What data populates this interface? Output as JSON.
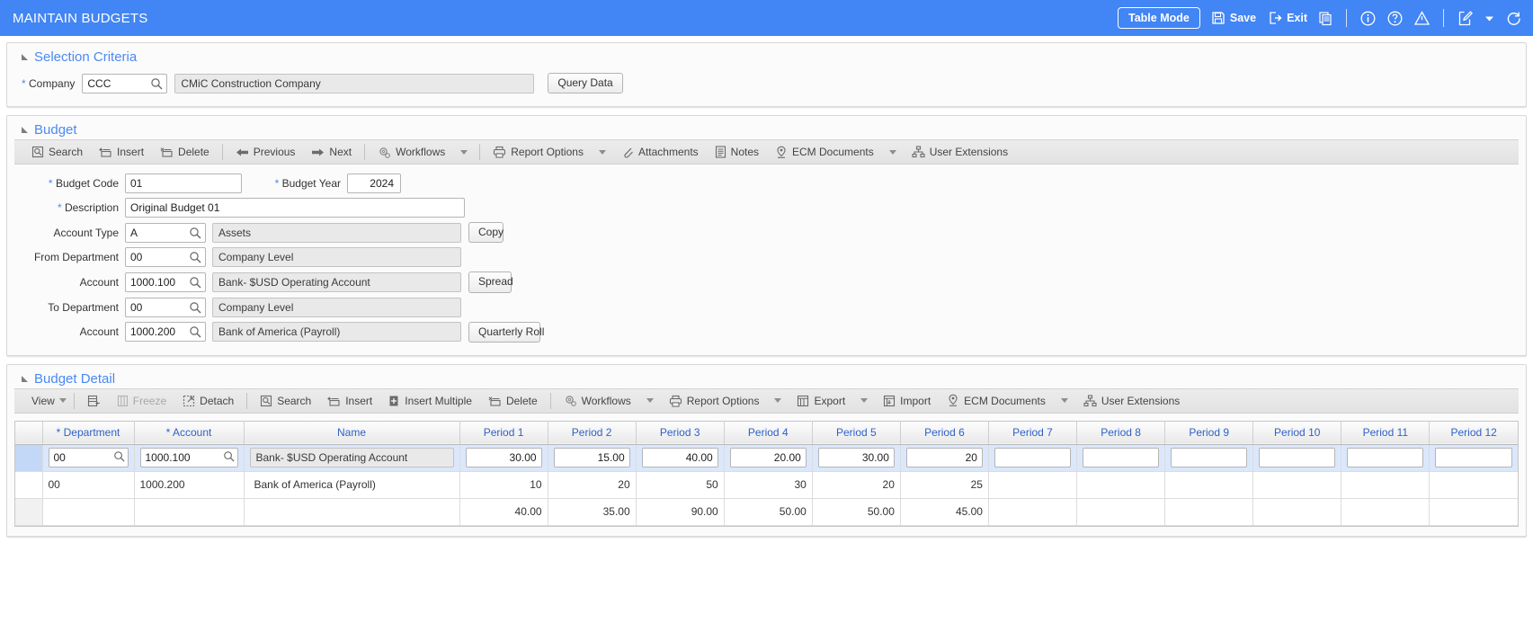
{
  "appbar": {
    "title": "MAINTAIN BUDGETS",
    "table_mode": "Table Mode",
    "save": "Save",
    "exit": "Exit",
    "accent": "#4285f4",
    "icons": [
      "copy-icon",
      "info-icon",
      "help-icon",
      "warning-icon",
      "edit-icon",
      "chevron-down-icon",
      "refresh-icon"
    ]
  },
  "selection_criteria": {
    "title": "Selection Criteria",
    "company_label": "Company",
    "company_code": "CCC",
    "company_name": "CMiC Construction Company",
    "query_data": "Query Data"
  },
  "budget": {
    "title": "Budget",
    "toolbar": [
      {
        "label": "Search",
        "icon": "search-icon",
        "caret": false
      },
      {
        "label": "Insert",
        "icon": "insert-icon",
        "caret": false
      },
      {
        "label": "Delete",
        "icon": "delete-icon",
        "caret": false
      },
      {
        "label": "Previous",
        "icon": "arrow-left-icon",
        "caret": false
      },
      {
        "label": "Next",
        "icon": "arrow-right-icon",
        "caret": false
      },
      {
        "label": "Workflows",
        "icon": "workflows-icon",
        "caret": true
      },
      {
        "label": "Report Options",
        "icon": "printer-icon",
        "caret": true
      },
      {
        "label": "Attachments",
        "icon": "paperclip-icon",
        "caret": false
      },
      {
        "label": "Notes",
        "icon": "notes-icon",
        "caret": false
      },
      {
        "label": "ECM Documents",
        "icon": "ecm-icon",
        "caret": true
      },
      {
        "label": "User Extensions",
        "icon": "user-extensions-icon",
        "caret": false
      }
    ],
    "fields": {
      "budget_code_label": "Budget Code",
      "budget_code": "01",
      "budget_year_label": "Budget Year",
      "budget_year": "2024",
      "description_label": "Description",
      "description": "Original Budget 01",
      "account_type_label": "Account Type",
      "account_type_code": "A",
      "account_type_name": "Assets",
      "from_department_label": "From Department",
      "from_department_code": "00",
      "from_department_name": "Company Level",
      "from_account_label": "Account",
      "from_account_code": "1000.100",
      "from_account_name": "Bank- $USD Operating Account",
      "to_department_label": "To Department",
      "to_department_code": "00",
      "to_department_name": "Company Level",
      "to_account_label": "Account",
      "to_account_code": "1000.200",
      "to_account_name": "Bank of America (Payroll)"
    },
    "buttons": {
      "copy": "Copy",
      "spread": "Spread",
      "quarterly_roll": "Quarterly Roll"
    }
  },
  "budget_detail": {
    "title": "Budget Detail",
    "toolbar": [
      {
        "label": "View",
        "icon": "view-icon",
        "caret": true,
        "disabled": false
      },
      {
        "label": "",
        "icon": "detach-columns-icon",
        "caret": false,
        "disabled": false
      },
      {
        "label": "Freeze",
        "icon": "freeze-icon",
        "caret": false,
        "disabled": true
      },
      {
        "label": "Detach",
        "icon": "detach-icon",
        "caret": false,
        "disabled": false
      },
      {
        "label": "Search",
        "icon": "search-icon",
        "caret": false,
        "disabled": false
      },
      {
        "label": "Insert",
        "icon": "insert-icon",
        "caret": false,
        "disabled": false
      },
      {
        "label": "Insert Multiple",
        "icon": "insert-multiple-icon",
        "caret": false,
        "disabled": false
      },
      {
        "label": "Delete",
        "icon": "delete-icon",
        "caret": false,
        "disabled": false
      },
      {
        "label": "Workflows",
        "icon": "workflows-icon",
        "caret": true,
        "disabled": false
      },
      {
        "label": "Report Options",
        "icon": "printer-icon",
        "caret": true,
        "disabled": false
      },
      {
        "label": "Export",
        "icon": "export-icon",
        "caret": true,
        "disabled": false
      },
      {
        "label": "Import",
        "icon": "import-icon",
        "caret": false,
        "disabled": false
      },
      {
        "label": "ECM Documents",
        "icon": "ecm-icon",
        "caret": true,
        "disabled": false
      },
      {
        "label": "User Extensions",
        "icon": "user-extensions-icon",
        "caret": false,
        "disabled": false
      }
    ],
    "columns": [
      "* Department",
      "* Account",
      "Name",
      "Period 1",
      "Period 2",
      "Period 3",
      "Period 4",
      "Period 5",
      "Period 6",
      "Period 7",
      "Period 8",
      "Period 9",
      "Period 10",
      "Period 11",
      "Period 12"
    ],
    "rows": [
      {
        "selected": true,
        "department": "00",
        "account": "1000.100",
        "name": "Bank- $USD Operating Account",
        "periods": [
          "30.00",
          "15.00",
          "40.00",
          "20.00",
          "30.00",
          "20",
          "",
          "",
          "",
          "",
          "",
          ""
        ]
      },
      {
        "selected": false,
        "department": "00",
        "account": "1000.200",
        "name": "Bank of America (Payroll)",
        "periods": [
          "10",
          "20",
          "50",
          "30",
          "20",
          "25",
          "",
          "",
          "",
          "",
          "",
          ""
        ]
      }
    ],
    "totals": [
      "40.00",
      "35.00",
      "90.00",
      "50.00",
      "50.00",
      "45.00",
      "",
      "",
      "",
      "",
      "",
      ""
    ]
  }
}
